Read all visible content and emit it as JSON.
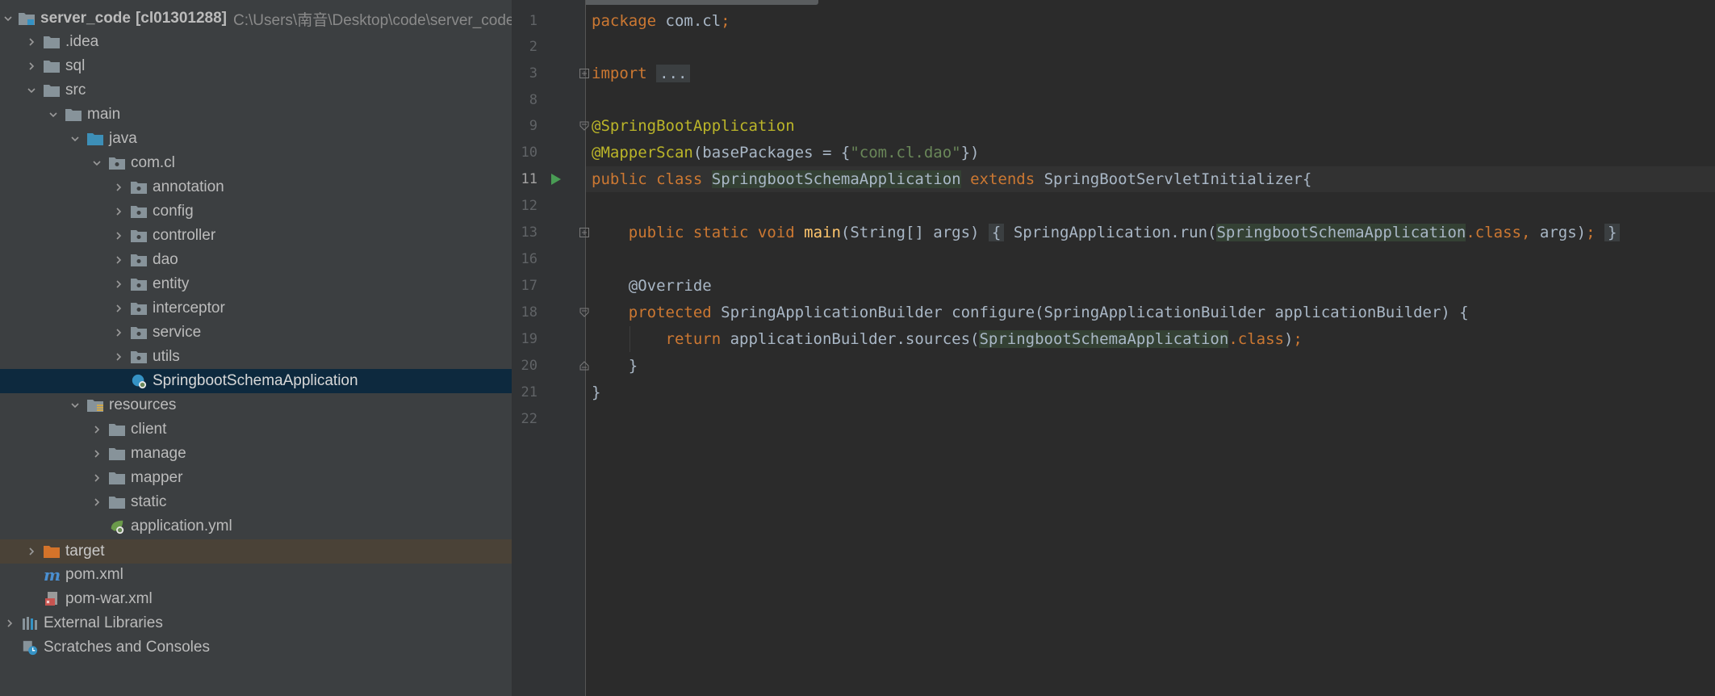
{
  "project_tree": {
    "root": {
      "name": "server_code",
      "module": "[cl01301288]",
      "path": "C:\\Users\\南音\\Desktop\\code\\server_code"
    },
    "items": [
      {
        "label": ".idea"
      },
      {
        "label": "sql"
      },
      {
        "label": "src"
      },
      {
        "label": "main"
      },
      {
        "label": "java"
      },
      {
        "label": "com.cl"
      },
      {
        "label": "annotation"
      },
      {
        "label": "config"
      },
      {
        "label": "controller"
      },
      {
        "label": "dao"
      },
      {
        "label": "entity"
      },
      {
        "label": "interceptor"
      },
      {
        "label": "service"
      },
      {
        "label": "utils"
      },
      {
        "label": "SpringbootSchemaApplication"
      },
      {
        "label": "resources"
      },
      {
        "label": "client"
      },
      {
        "label": "manage"
      },
      {
        "label": "mapper"
      },
      {
        "label": "static"
      },
      {
        "label": "application.yml"
      },
      {
        "label": "target"
      },
      {
        "label": "pom.xml"
      },
      {
        "label": "pom-war.xml"
      },
      {
        "label": "External Libraries"
      },
      {
        "label": "Scratches and Consoles"
      }
    ]
  },
  "editor": {
    "line_numbers": [
      "1",
      "2",
      "3",
      "8",
      "9",
      "10",
      "11",
      "12",
      "13",
      "16",
      "17",
      "18",
      "19",
      "20",
      "21",
      "22"
    ],
    "current_line": "11",
    "code": {
      "l1_kw": "package",
      "l1_rest": " com.cl",
      "l1_semi": ";",
      "l3_kw": "import",
      "l3_fold": "...",
      "l9_ann": "@SpringBootApplication",
      "l10_ann": "@MapperScan",
      "l10_a": "(basePackages = {",
      "l10_str": "\"com.cl.dao\"",
      "l10_b": "})",
      "l11_kw1": "public",
      "l11_kw2": "class",
      "l11_cls": "SpringbootSchemaApplication",
      "l11_kw3": "extends",
      "l11_rest": " SpringBootServletInitializer{",
      "l13_kw": "public static void",
      "l13_fn": "main",
      "l13_args": "(String[] args) ",
      "l13_ob": "{",
      "l13_call": " SpringApplication.run(",
      "l13_cls": "SpringbootSchemaApplication",
      "l13_dotclass": ".class",
      "l13_comma": ",",
      "l13_end": " args)",
      "l13_semi": ";",
      "l13_cb": "}",
      "l17_ann": "@Override",
      "l18_kw": "protected",
      "l18_rest": " SpringApplicationBuilder configure(SpringApplicationBuilder applicationBuilder) {",
      "l19_kw": "return",
      "l19_call": " applicationBuilder.sources(",
      "l19_cls": "SpringbootSchemaApplication",
      "l19_dotclass": ".class",
      "l19_end": ")",
      "l19_semi": ";",
      "l20": "}",
      "l21": "}"
    }
  },
  "colors": {
    "keyword": "#cc7832",
    "annotation": "#bbb529",
    "string": "#6a8759",
    "function": "#ffc66d",
    "text": "#a9b7c6",
    "selection": "#0d293e"
  }
}
